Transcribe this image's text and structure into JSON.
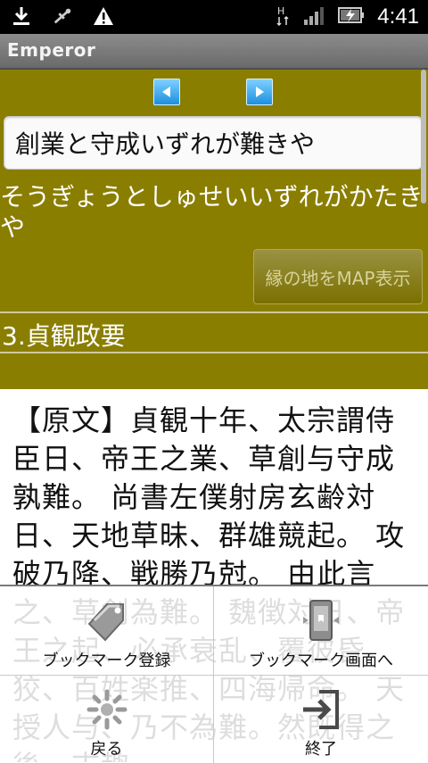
{
  "status_bar": {
    "time": "4:41",
    "icons": [
      "download-icon",
      "usb-debug-icon",
      "warning-icon",
      "hsdpa-icon",
      "signal-icon",
      "battery-charging-icon"
    ]
  },
  "app": {
    "title": "Emperor"
  },
  "nav": {
    "prev_icon": "arrow-left-icon",
    "next_icon": "arrow-right-icon"
  },
  "phrase": {
    "text": "創業と守成いずれが難きや",
    "reading": "そうぎょうとしゅせいいずれがかたきや"
  },
  "map_button": {
    "label": "縁の地をMAP表示"
  },
  "section": {
    "title": "3.貞観政要"
  },
  "body_text": "【原文】貞観十年、太宗謂侍臣日、帝王之業、草創与守成孰難。 尚書左僕射房玄齢対日、天地草昧、群雄競起。 攻破乃降、戦勝乃尅。 由此言之、草創為難。 魏徴対日、帝王之起、必承衰乱、覆彼昏狡、百姓楽推、四海帰命。 天授人与、乃不為難。然既得之後、志趣",
  "menu": {
    "items": [
      {
        "label": "ブックマーク登録",
        "icon": "bookmark-add-icon"
      },
      {
        "label": "ブックマーク画面へ",
        "icon": "bookmark-view-icon"
      },
      {
        "label": "戻る",
        "icon": "back-icon"
      },
      {
        "label": "終了",
        "icon": "exit-icon"
      }
    ]
  },
  "colors": {
    "panel": "#8a7e00",
    "accent_blue": "#1c8fe0"
  }
}
